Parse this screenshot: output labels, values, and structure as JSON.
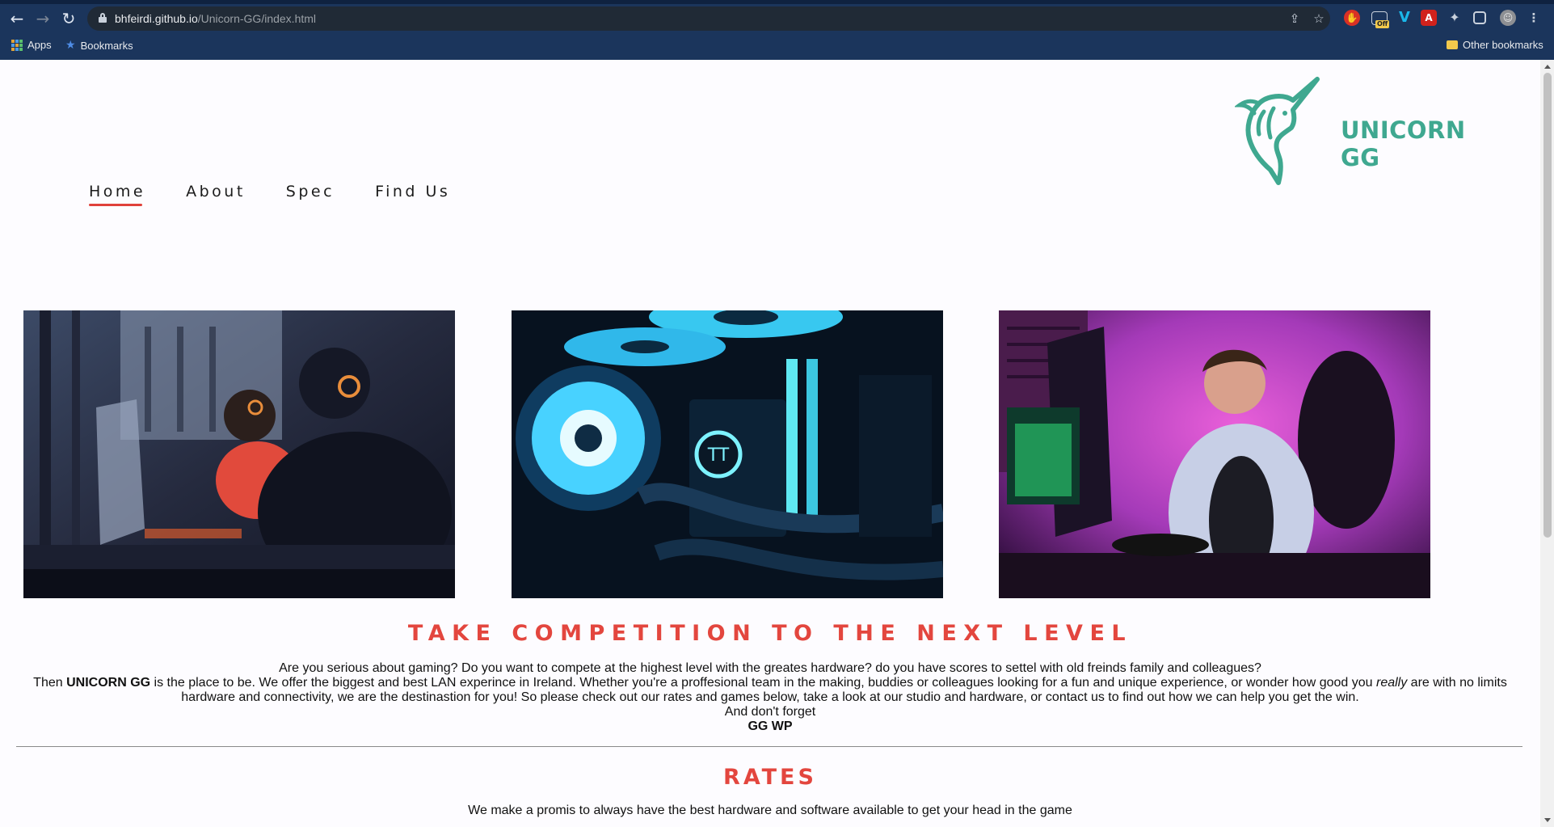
{
  "browser": {
    "url_host": "bhfeirdi.github.io",
    "url_path": "/Unicorn-GG/index.html",
    "bookmarks": {
      "apps": "Apps",
      "bookmarks": "Bookmarks",
      "other": "Other bookmarks"
    },
    "extension_badge": "Off"
  },
  "site": {
    "logo_text": "UNICORN GG",
    "nav": [
      {
        "label": "Home",
        "active": true
      },
      {
        "label": "About",
        "active": false
      },
      {
        "label": "Spec",
        "active": false
      },
      {
        "label": "Find Us",
        "active": false
      }
    ],
    "headline": "TAKE COMPETITION TO THE NEXT LEVEL",
    "intro": {
      "line1": "Are you serious about gaming? Do you want to compete at the highest level with the greates hardware? do you have scores to settel with old freinds family and colleagues?",
      "line2_start": "Then ",
      "line2_brand": "UNICORN GG",
      "line2_mid": " is the place to be. We offer the biggest and best LAN experince in Ireland. Whether you're a proffesional team in the making, buddies or colleagues looking for a fun and unique experience, or wonder how good you ",
      "line2_em": "really",
      "line2_end": " are with no limits hardware and connectivity, we are the destinastion for you! So please check out our rates and games below, take a look at our studio and hardware, or contact us to find out how we can help you get the win.",
      "line3": "And don't forget",
      "line4": "GG WP"
    },
    "rates_heading": "RATES",
    "rates_text": "We make a promis to always have the best hardware and software available to get your head in the game"
  }
}
